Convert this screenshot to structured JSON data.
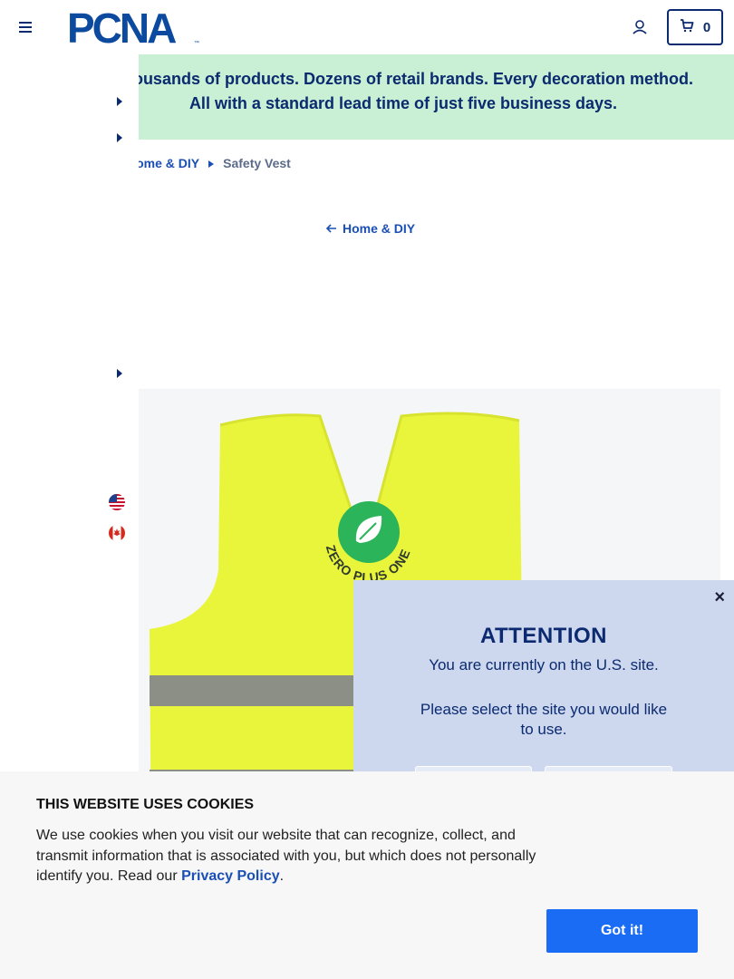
{
  "header": {
    "logo_text": "PCNA",
    "cart_count": "0"
  },
  "promo": {
    "text": "Thousands of products. Dozens of retail brands. Every decoration method. All with a standard lead time of just five business days."
  },
  "breadcrumb": {
    "parent": "Home & DIY",
    "current": "Safety Vest"
  },
  "back_link": {
    "label": "Home & DIY"
  },
  "product": {
    "imprint_text": "ZERO PLUS ONE",
    "colors": {
      "vest": "#e9f53a",
      "stripe": "#8c8f86",
      "imprint": "#2bb45a"
    }
  },
  "site_modal": {
    "close": "×",
    "title": "ATTENTION",
    "line1": "You are currently on the U.S. site.",
    "line2": "Please select the site you would like to use."
  },
  "cookie": {
    "title": "THIS WEBSITE USES COOKIES",
    "text_before": "We use cookies when you visit our website that can recognize, collect, and transmit information that is associated with you, but which does not personally identify you. Read our ",
    "link": "Privacy Policy",
    "text_after": ".",
    "button": "Got it!"
  },
  "colors": {
    "brand_navy": "#0b2a6f",
    "promo_bg": "#c9f0d4",
    "link_blue": "#1a4fb4",
    "cookie_button": "#1a6cf5",
    "modal_bg": "#cdd8ef"
  }
}
